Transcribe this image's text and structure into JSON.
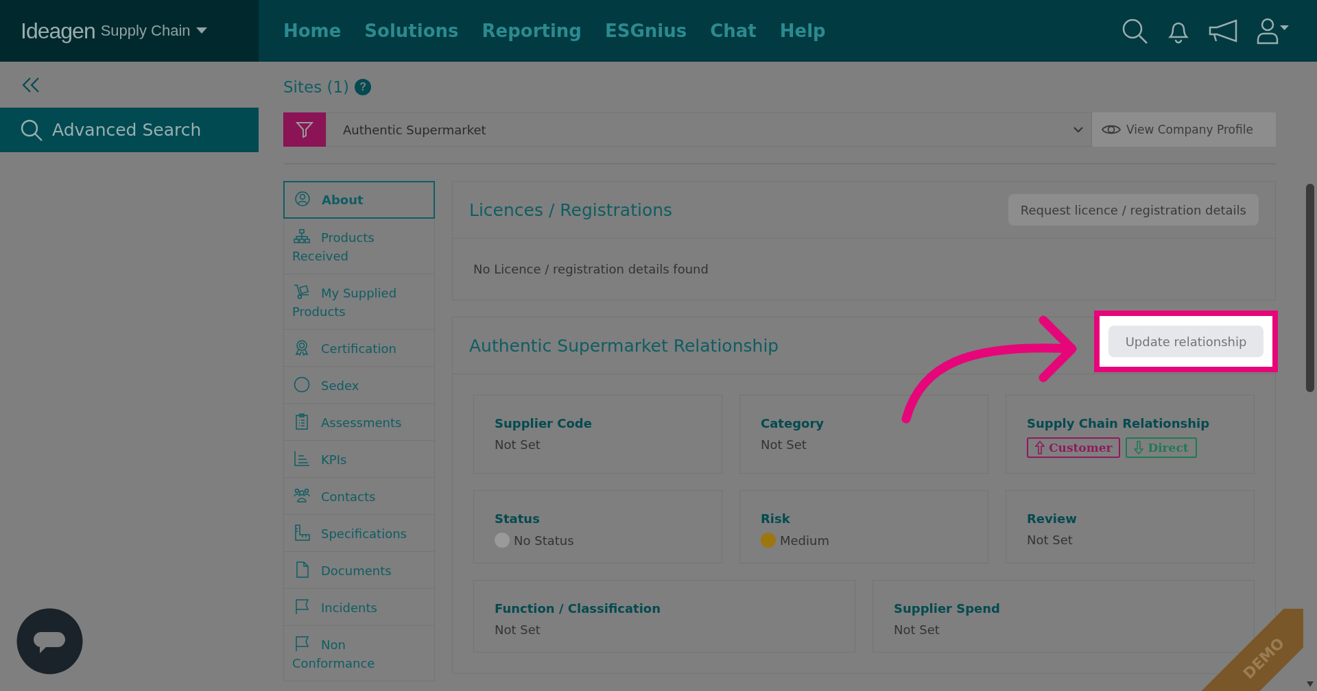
{
  "brand": {
    "logo": "Ideagen",
    "product": "Supply Chain"
  },
  "nav": [
    {
      "label": "Home"
    },
    {
      "label": "Solutions"
    },
    {
      "label": "Reporting"
    },
    {
      "label": "ESGnius"
    },
    {
      "label": "Chat"
    },
    {
      "label": "Help"
    }
  ],
  "sidebar": {
    "search": "Advanced Search"
  },
  "sites": {
    "title": "Sites (1)",
    "help": "?"
  },
  "filter": {
    "value": "Authentic Supermarket",
    "profile_button": "View Company Profile"
  },
  "tabs": [
    {
      "label": "About",
      "selected": true
    },
    {
      "label": "Products Received",
      "selected": false
    },
    {
      "label": "My Supplied Products",
      "selected": false
    },
    {
      "label": "Certification",
      "selected": false
    },
    {
      "label": "Sedex",
      "selected": false
    },
    {
      "label": "Assessments",
      "selected": false
    },
    {
      "label": "KPIs",
      "selected": false
    },
    {
      "label": "Contacts",
      "selected": false
    },
    {
      "label": "Specifications",
      "selected": false
    },
    {
      "label": "Documents",
      "selected": false
    },
    {
      "label": "Incidents",
      "selected": false
    },
    {
      "label": "Non Conformance",
      "selected": false
    }
  ],
  "licences": {
    "title": "Licences / Registrations",
    "button": "Request licence / registration details",
    "message": "No Licence / registration details found"
  },
  "relationship": {
    "title": "Authentic Supermarket Relationship",
    "button": "Update relationship",
    "highlighted": true,
    "cards": [
      {
        "kind": "text",
        "label": "Supplier Code",
        "value": "Not Set"
      },
      {
        "kind": "text",
        "label": "Category",
        "value": "Not Set"
      },
      {
        "kind": "tags",
        "label": "Supply Chain Relationship",
        "tags": [
          {
            "label": "Customer",
            "color": "#8e1a5e"
          },
          {
            "label": "Direct",
            "color": "#1d7a55"
          }
        ]
      },
      {
        "kind": "dot",
        "label": "Status",
        "value": "No Status",
        "color": "#9a9a9a"
      },
      {
        "kind": "dot",
        "label": "Risk",
        "value": "Medium",
        "color": "#9c760f"
      },
      {
        "kind": "text",
        "label": "Review",
        "value": "Not Set"
      },
      {
        "kind": "text",
        "label": "Function / Classification",
        "value": "Not Set"
      },
      {
        "kind": "text",
        "label": "Supplier Spend",
        "value": "Not Set"
      }
    ]
  },
  "demo_ribbon": "DEMO"
}
